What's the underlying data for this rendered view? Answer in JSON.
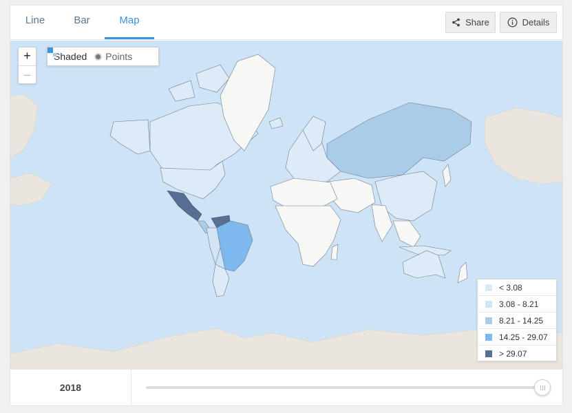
{
  "tabs": [
    {
      "label": "Line",
      "active": false
    },
    {
      "label": "Bar",
      "active": false
    },
    {
      "label": "Map",
      "active": true
    }
  ],
  "toolbar": {
    "share_label": "Share",
    "details_label": "Details",
    "share_icon": "share-icon",
    "details_icon": "info-icon"
  },
  "map": {
    "zoom_in_label": "+",
    "zoom_out_label": "–",
    "modes": [
      {
        "label": "Shaded",
        "selected": true,
        "icon": "shaded-icon"
      },
      {
        "label": "Points",
        "selected": false,
        "icon": "points-icon"
      }
    ],
    "colors": {
      "ocean": "#cfe3f7",
      "land_no_data": "#f7f7f5",
      "land_outside": "#ebe6dd",
      "accent": "#3a93e6"
    },
    "legend": [
      {
        "label": "< 3.08",
        "color": "#d7ecfb"
      },
      {
        "label": "3.08 - 8.21",
        "color": "#d3e5f5"
      },
      {
        "label": "8.21 - 14.25",
        "color": "#a9cde9"
      },
      {
        "label": "14.25 - 29.07",
        "color": "#7db9ef"
      },
      {
        "label": "> 29.07",
        "color": "#576f94"
      }
    ]
  },
  "timeline": {
    "year": "2018",
    "position_fraction": 1.0
  }
}
